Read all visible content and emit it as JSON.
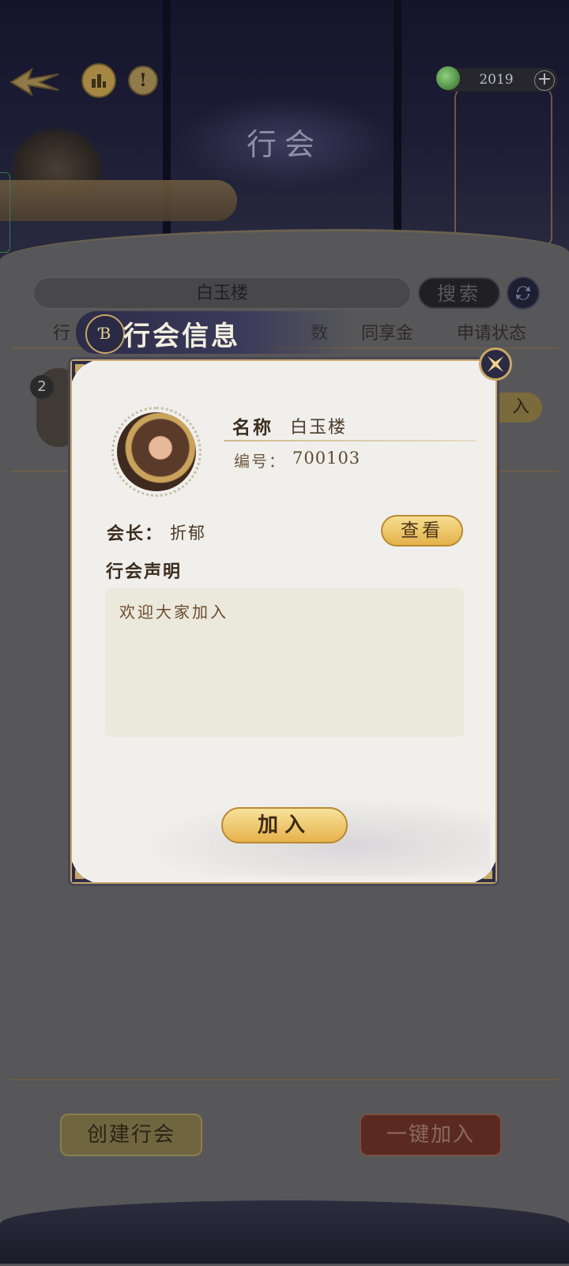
{
  "header": {
    "title": "行会",
    "currency_amount": "2019",
    "currency_plus": "+",
    "info_icon_glyph": "!"
  },
  "search": {
    "value": "白玉楼",
    "button_label": "搜索"
  },
  "list": {
    "columns": [
      "行",
      "数",
      "同享金",
      "申请状态"
    ],
    "rows": [
      {
        "rank": "2",
        "action_partial": "入"
      }
    ]
  },
  "bottom": {
    "create_label": "创建行会",
    "quick_join_label": "一键加入"
  },
  "modal": {
    "title": "行会信息",
    "emblem_glyph": "Ɓ",
    "name_label": "名称",
    "name_value": "白玉楼",
    "id_label": "编号：",
    "id_value": "700103",
    "leader_label": "会长：",
    "leader_value": "折郁",
    "view_label": "查看",
    "declaration_label": "行会声明",
    "declaration_text": "欢迎大家加入",
    "join_label": "加入"
  },
  "colors": {
    "gold": "#c9a866",
    "navy": "#2c2c48",
    "button_gold": "#e6b24c",
    "overlay_grey": "#575759"
  },
  "icons": [
    "back-arrow-icon",
    "ranking-icon",
    "info-icon",
    "jade-currency-icon",
    "refresh-icon",
    "close-icon",
    "guild-emblem-icon"
  ]
}
